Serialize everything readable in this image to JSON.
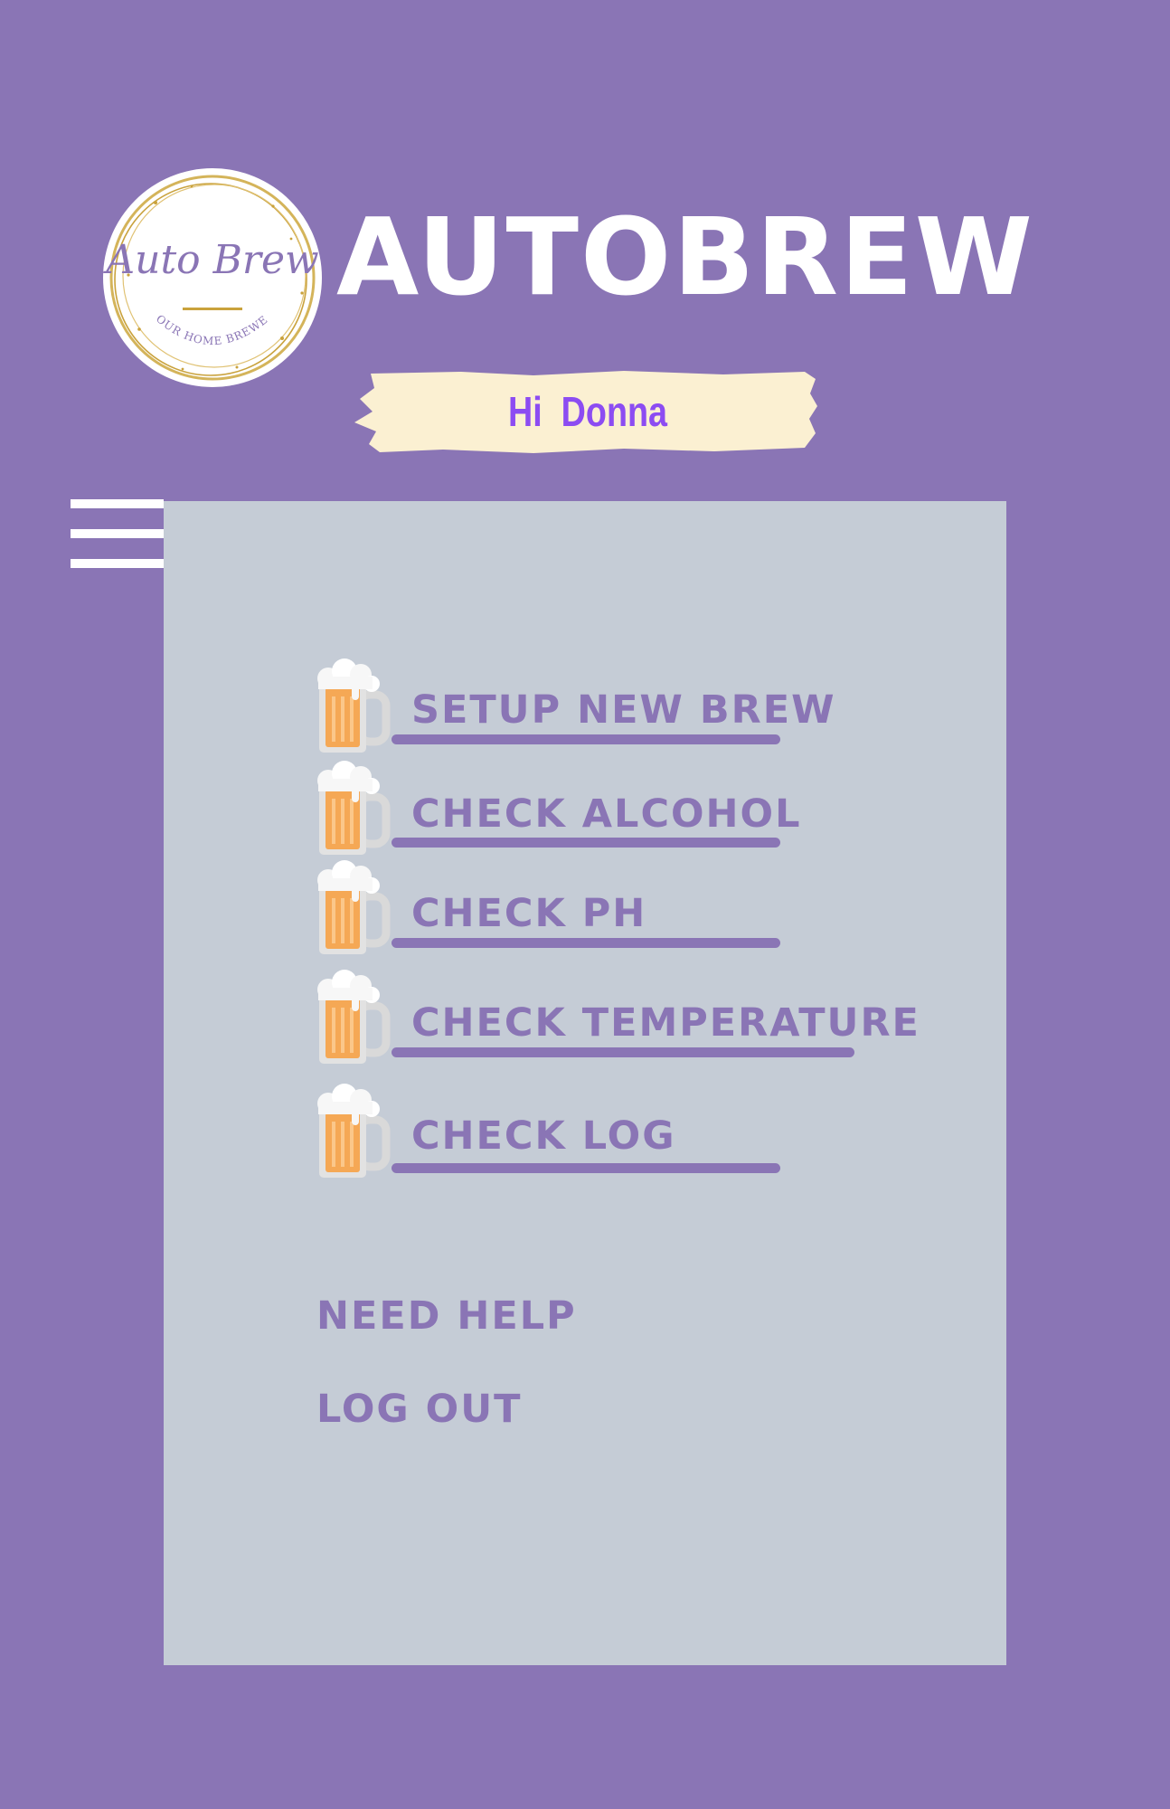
{
  "app": {
    "title": "AUTOBREW",
    "logo": {
      "script_text": "Auto Brew",
      "tagline": "YOUR HOME BREWER"
    }
  },
  "greeting": "Hi  Donna",
  "menu": {
    "items": [
      {
        "label": "SETUP NEW BREW",
        "icon": "beer-mug-icon"
      },
      {
        "label": "CHECK ALCOHOL",
        "icon": "beer-mug-icon"
      },
      {
        "label": "CHECK PH",
        "icon": "beer-mug-icon"
      },
      {
        "label": "CHECK TEMPERATURE",
        "icon": "beer-mug-icon"
      },
      {
        "label": "CHECK LOG",
        "icon": "beer-mug-icon"
      }
    ],
    "help_label": "NEED HELP",
    "logout_label": "LOG OUT"
  },
  "colors": {
    "background": "#8a75b5",
    "panel": "#c5ccd6",
    "accent": "#8a75b5",
    "greeting_text": "#8c4cf2",
    "greeting_banner": "#fbf0d2",
    "logo_gold": "#c9a23c"
  }
}
